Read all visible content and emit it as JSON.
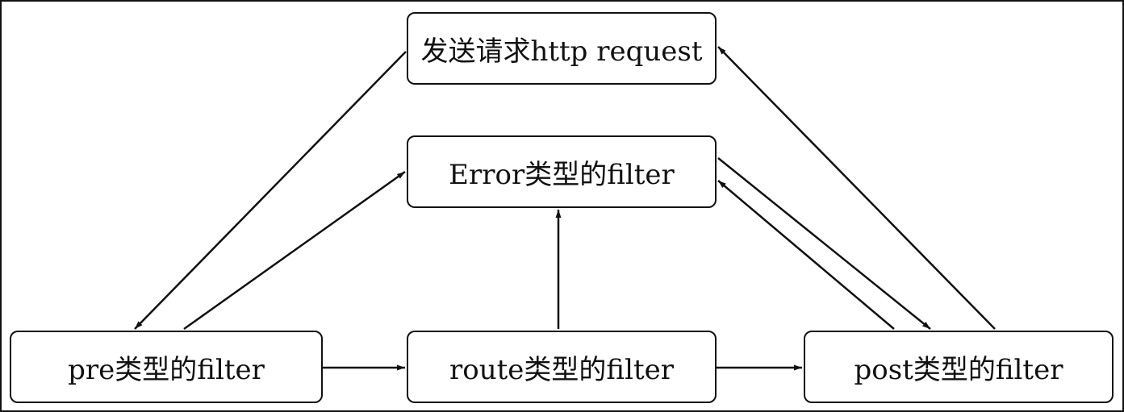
{
  "nodes": {
    "request": "发送请求http request",
    "error": "Error类型的filter",
    "pre": "pre类型的filter",
    "route": "route类型的filter",
    "post": "post类型的filter"
  },
  "edges": [
    {
      "from": "request",
      "to": "pre"
    },
    {
      "from": "pre",
      "to": "error"
    },
    {
      "from": "pre",
      "to": "route"
    },
    {
      "from": "route",
      "to": "error"
    },
    {
      "from": "route",
      "to": "post"
    },
    {
      "from": "error",
      "to": "post"
    },
    {
      "from": "post",
      "to": "error"
    },
    {
      "from": "post",
      "to": "request"
    }
  ],
  "colors": {
    "line": "#111111",
    "background": "#ffffff"
  }
}
